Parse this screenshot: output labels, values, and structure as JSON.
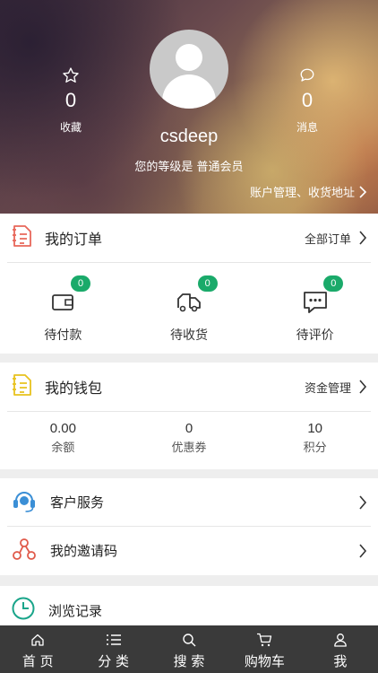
{
  "profile": {
    "username": "csdeep",
    "level_text": "您的等级是 普通会员",
    "account_link": "账户管理、收货地址",
    "favorites": {
      "count": "0",
      "label": "收藏",
      "icon": "star-icon"
    },
    "messages": {
      "count": "0",
      "label": "消息",
      "icon": "chat-bubble-icon"
    }
  },
  "orders": {
    "title": "我的订单",
    "all_label": "全部订单",
    "items": [
      {
        "label": "待付款",
        "badge": "0",
        "icon": "wallet-icon"
      },
      {
        "label": "待收货",
        "badge": "0",
        "icon": "truck-icon"
      },
      {
        "label": "待评价",
        "badge": "0",
        "icon": "comment-icon"
      }
    ]
  },
  "wallet": {
    "title": "我的钱包",
    "manage_label": "资金管理",
    "items": [
      {
        "value": "0.00",
        "label": "余额"
      },
      {
        "value": "0",
        "label": "优惠券"
      },
      {
        "value": "10",
        "label": "积分"
      }
    ]
  },
  "services": {
    "customer_service": "客户服务",
    "invite_code": "我的邀请码"
  },
  "history": {
    "title": "浏览记录"
  },
  "tabbar": {
    "items": [
      {
        "label": "首 页",
        "icon": "home-icon"
      },
      {
        "label": "分 类",
        "icon": "list-icon"
      },
      {
        "label": "搜 索",
        "icon": "search-icon"
      },
      {
        "label": "购物车",
        "icon": "cart-icon"
      },
      {
        "label": "我",
        "icon": "user-icon"
      }
    ]
  },
  "colors": {
    "badge_green": "#1aaa6a",
    "tabbar_bg": "#3a3a3a",
    "orders_icon_red": "#e8675a",
    "wallet_icon_yellow": "#e8c21e",
    "service_icon_blue": "#3b8fd6",
    "invite_icon_red": "#e05a4a",
    "history_icon_teal": "#1aa58a"
  }
}
